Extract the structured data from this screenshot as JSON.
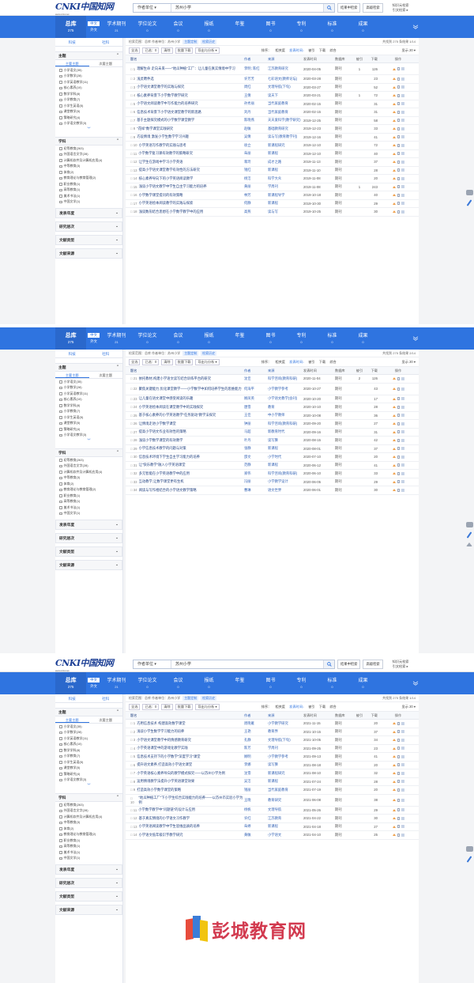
{
  "header": {
    "search_field": "作者单位 ▾",
    "search_value": "苏州小学",
    "btn_in_result": "结果中检索",
    "btn_advanced": "高级检索",
    "right_line1": "知识元检索",
    "right_line2": "引文检索 ▸"
  },
  "tabbar": {
    "zongku_label": "总库",
    "zongku_count": "275",
    "lang_zh": "中文",
    "lang_foreign": "外文",
    "tabs": [
      {
        "label": "学术期刊",
        "count": "21"
      },
      {
        "label": "学位论文",
        "count": "0"
      },
      {
        "label": "会议",
        "count": "0"
      },
      {
        "label": "报纸",
        "count": "0"
      },
      {
        "label": "年鉴",
        "count": ""
      },
      {
        "label": "图书",
        "count": "0"
      },
      {
        "label": "专利",
        "count": "0"
      },
      {
        "label": "标准",
        "count": "0"
      },
      {
        "label": "成果",
        "count": "0"
      }
    ]
  },
  "sidebar": {
    "tab_science": "科技",
    "tab_social": "社科",
    "topic_header": "主题",
    "topic_tab_main": "主要主题",
    "topic_tab_sub": "次要主题",
    "topics": [
      "小学语文(35)",
      "小学数学(28)",
      "小学英语教学(11)",
      "核心素养(10)",
      "数学学科(8)",
      "小学教育(7)",
      "小学生英语(5)",
      "课堂教学(5)",
      "策略研究(4)",
      "小学语文教学(3)"
    ],
    "subject_header": "学科",
    "subjects": [
      "初等教育(263)",
      "外国语言文字(28)",
      "计算机软件及计算机应用(4)",
      "中等教育(3)",
      "体育(2)",
      "教育理论与教育管理(2)",
      "职业教育(1)",
      "高等教育(1)",
      "美术书法(1)",
      "中国文学(1)"
    ],
    "more": "︾",
    "collapsed": [
      "发表年度",
      "研究层次",
      "文献类型",
      "文献来源"
    ]
  },
  "results": {
    "crumbs_label": "检索范围：总库",
    "crumbs_query": "作者单位：苏州小学",
    "tag_main": "主题定制",
    "tag_history": "检索历史",
    "total": "共找到 275 条结果",
    "toolbar": {
      "select_all": "全选",
      "selected": "已选：0",
      "clear": "清除",
      "batch_download": "批量下载",
      "export": "导出与分析 ▾",
      "sort_label": "排序：",
      "sort_relevance": "相关度",
      "sort_date": "发表时间↓",
      "sort_cite": "被引",
      "sort_download": "下载",
      "sort_comprehensive": "综合",
      "display": "显示 20 ▾"
    },
    "columns": [
      "题名",
      "作者",
      "来源",
      "发表时间",
      "数据库",
      "被引",
      "下载",
      "操作"
    ],
    "page1": {
      "pager": "1/14",
      "rows": [
        {
          "idx": "□ 1",
          "title": "理解生命 走向未来——\"地瓜种植\"工厂：让儿童在真实情境中学习",
          "author": "李明; 陈红",
          "source": "江苏教育研究",
          "date": "2020-04-05",
          "db": "期刊",
          "cite": "1",
          "dl": "126"
        },
        {
          "idx": "□ 2",
          "title": "浅灵聘件选",
          "author": "许芳芳",
          "source": "七彩语文(教师论坛)",
          "date": "2020-03-28",
          "db": "期刊",
          "cite": "",
          "dl": "23"
        },
        {
          "idx": "□ 3",
          "title": "小学语文课堂教学的实践与探究",
          "author": "周红",
          "source": "文理导航(下旬)",
          "date": "2020-03-27",
          "db": "期刊",
          "cite": "",
          "dl": "52"
        },
        {
          "idx": "□ 4",
          "title": "核心素养背景下小学数学教学研究",
          "author": "王倩",
          "source": "读天下",
          "date": "2020-03-21",
          "db": "期刊",
          "cite": "1",
          "dl": "72"
        },
        {
          "idx": "□ 5",
          "title": "小学语文阅读教学中写作能力的培养研究",
          "author": "孙秀丽",
          "source": "当代家庭教育",
          "date": "2020-02-15",
          "db": "期刊",
          "cite": "",
          "dl": "31"
        },
        {
          "idx": "□ 6",
          "title": "信息技术背景下小学语文课堂教学的新思路",
          "author": "刘丹",
          "source": "当代家庭教育",
          "date": "2020-02-15",
          "db": "期刊",
          "cite": "",
          "dl": "31"
        },
        {
          "idx": "□ 7",
          "title": "基于主题探究模式的小学数学课堂教学",
          "author": "陈晓燕",
          "source": "天天爱科学(教学研究)",
          "date": "2019-12-25",
          "db": "期刊",
          "cite": "",
          "dl": "58"
        },
        {
          "idx": "□ 8",
          "title": "\"花样\"数学课堂实践研究",
          "author": "赵敏",
          "source": "基础教育研究",
          "date": "2019-12-23",
          "db": "期刊",
          "cite": "",
          "dl": "33"
        },
        {
          "idx": "□ 9",
          "title": "巧设情境 激发小学生数学学习兴趣",
          "author": "吴倩",
          "source": "读与写(教育教学刊)",
          "date": "2019-12-16",
          "db": "期刊",
          "cite": "",
          "dl": "41"
        },
        {
          "idx": "□ 10",
          "title": "小学英语写作教学的实践与思考",
          "author": "徐立",
          "source": "新课程研究",
          "date": "2019-12-10",
          "db": "期刊",
          "cite": "",
          "dl": "72"
        },
        {
          "idx": "□ 11",
          "title": "小学数学复习课有效教学的策略研究",
          "author": "朱丽",
          "source": "新课程",
          "date": "2019-12-10",
          "db": "期刊",
          "cite": "",
          "dl": "40"
        },
        {
          "idx": "□ 12",
          "title": "让学生在游戏中学习小学英语",
          "author": "蒋玲",
          "source": "成才之路",
          "date": "2019-11-13",
          "db": "期刊",
          "cite": "",
          "dl": "37"
        },
        {
          "idx": "□ 13",
          "title": "提高小学语文课堂教学有效性的方法研究",
          "author": "钱红",
          "source": "新课程",
          "date": "2019-11-10",
          "db": "期刊",
          "cite": "",
          "dl": "28"
        },
        {
          "idx": "□ 14",
          "title": "核心素养导向下的小学英语阅读教学",
          "author": "杨洁",
          "source": "科学大众",
          "date": "2019-11-08",
          "db": "期刊",
          "cite": "",
          "dl": "20"
        },
        {
          "idx": "□ 15",
          "title": "浅谈小学语文教学中学生自主学习能力的培养",
          "author": "黄丽",
          "source": "学周刊",
          "date": "2019-11-08",
          "db": "期刊",
          "cite": "1",
          "dl": "243"
        },
        {
          "idx": "□ 16",
          "title": "小学数学课堂提问的有效策略",
          "author": "林芳",
          "source": "新课程导学",
          "date": "2019-10-18",
          "db": "期刊",
          "cite": "",
          "dl": "40"
        },
        {
          "idx": "□ 17",
          "title": "小学英语绘本阅读教学的实践与探索",
          "author": "何静",
          "source": "新课程",
          "date": "2019-10-30",
          "db": "期刊",
          "cite": "",
          "dl": "29"
        },
        {
          "idx": "□ 18",
          "title": "浅谈数形结合思想在小学数学教学中的应用",
          "author": "高燕",
          "source": "读与写",
          "date": "2019-10-25",
          "db": "期刊",
          "cite": "",
          "dl": "30"
        }
      ]
    },
    "page2": {
      "pager": "2/14",
      "rows": [
        {
          "idx": "□ 21",
          "title": "依托教材,构建小学语文读写结合训练平台的研究",
          "author": "沈佳",
          "source": "科学咨询(教育科研)",
          "date": "2020-11-04",
          "db": "期刊",
          "cite": "2",
          "dl": "126"
        },
        {
          "idx": "□ 22",
          "title": "聚焦关键能力,优化课堂教学——小学数学中如何培养学生的思维能力",
          "author": "何海平",
          "source": "小学教学参考",
          "date": "2020-10-27",
          "db": "期刊",
          "cite": "",
          "dl": "43"
        },
        {
          "idx": "□ 23",
          "title": "让儿童在语文课堂中感受阅读的乐趣",
          "author": "顾凤英",
          "source": "小学语文教学(会刊)",
          "date": "2020-10-20",
          "db": "期刊",
          "cite": "",
          "dl": "17"
        },
        {
          "idx": "□ 24",
          "title": "小学英语绘本阅读在课堂教学中的实践探究",
          "author": "唐雪",
          "source": "教育",
          "date": "2020-10-10",
          "db": "期刊",
          "cite": "",
          "dl": "28"
        },
        {
          "idx": "□ 25",
          "title": "基于核心素养的小学英语教学\"任务驱动\"教学法探究",
          "author": "王佳",
          "source": "中小学教师",
          "date": "2020-10-08",
          "db": "期刊",
          "cite": "",
          "dl": "36"
        },
        {
          "idx": "□ 26",
          "title": "让情境走进小学数学课堂",
          "author": "钟丽",
          "source": "科学咨询(教育科研)",
          "date": "2020-09-20",
          "db": "期刊",
          "cite": "",
          "dl": "27"
        },
        {
          "idx": "□ 27",
          "title": "提高小学语文作业有效性的策略",
          "author": "马超",
          "source": "新教育时代",
          "date": "2020-09-16",
          "db": "期刊",
          "cite": "",
          "dl": "31"
        },
        {
          "idx": "□ 28",
          "title": "浅谈小学数学课堂的有效教学",
          "author": "叶丹",
          "source": "读写算",
          "date": "2020-08-15",
          "db": "期刊",
          "cite": "",
          "dl": "42"
        },
        {
          "idx": "□ 29",
          "title": "小学信息技术教学的问题与对策",
          "author": "张静",
          "source": "新课程",
          "date": "2020-08-01",
          "db": "期刊",
          "cite": "",
          "dl": "37"
        },
        {
          "idx": "□ 30",
          "title": "信息技术环境下学生自主学习能力的培养",
          "author": "邵文",
          "source": "小学时代",
          "date": "2020-07-10",
          "db": "期刊",
          "cite": "",
          "dl": "20"
        },
        {
          "idx": "□ 31",
          "title": "让\"快乐教学\"融入小学英语课堂",
          "author": "范静",
          "source": "新课程",
          "date": "2020-06-12",
          "db": "期刊",
          "cite": "",
          "dl": "41"
        },
        {
          "idx": "□ 32",
          "title": "多元智能在小学英语教学中的应用",
          "author": "郑伟",
          "source": "科学咨询(教育科研)",
          "date": "2020-06-10",
          "db": "期刊",
          "cite": "",
          "dl": "33"
        },
        {
          "idx": "□ 33",
          "title": "互动教学,让数学课堂更有生机",
          "author": "冯丽",
          "source": "小学教学设计",
          "date": "2020-06-05",
          "db": "期刊",
          "cite": "",
          "dl": "29"
        },
        {
          "idx": "□ 34",
          "title": "阅读与写作相结合的小学语文教学策略",
          "author": "曹琳",
          "source": "语文世界",
          "date": "2020-06-01",
          "db": "期刊",
          "cite": "",
          "dl": "30"
        }
      ]
    },
    "page3": {
      "pager": "1/14",
      "rows": [
        {
          "idx": "□ 1",
          "title": "巧用信息技术 构建高效数学课堂",
          "author": "周晓雁",
          "source": "小学教学研究",
          "date": "2021-11-15",
          "db": "期刊",
          "cite": "",
          "dl": "20"
        },
        {
          "idx": "□ 2",
          "title": "浅谈小学生数学学习能力的培养",
          "author": "王艳",
          "source": "教育界",
          "date": "2021-10-15",
          "db": "期刊",
          "cite": "",
          "dl": "37"
        },
        {
          "idx": "□ 3",
          "title": "小学语文课堂教学中的情感教育研究",
          "author": "孔静",
          "source": "文理导航(下旬)",
          "date": "2021-10-05",
          "db": "期刊",
          "cite": "",
          "dl": "34"
        },
        {
          "idx": "□ 4",
          "title": "小学英语课堂中的游戏化教学实践",
          "author": "陈芳",
          "source": "学周刊",
          "date": "2021-09-25",
          "db": "期刊",
          "cite": "",
          "dl": "23"
        },
        {
          "idx": "□ 5",
          "title": "信息技术支持下的小学数学\"深度学习\"课堂",
          "author": "顾明",
          "source": "小学教学参考",
          "date": "2021-09-13",
          "db": "期刊",
          "cite": "",
          "dl": "41"
        },
        {
          "idx": "□ 6",
          "title": "提升语文素养,打造高效小学语文课堂",
          "author": "李娜",
          "source": "读写算",
          "date": "2021-08-18",
          "db": "期刊",
          "cite": "",
          "dl": "20"
        },
        {
          "idx": "□ 7",
          "title": "小学英语核心素养导向的教学模式探究——以苏州小学为例",
          "author": "沈雪",
          "source": "新课程研究",
          "date": "2021-08-10",
          "db": "期刊",
          "cite": "",
          "dl": "32"
        },
        {
          "idx": "□ 8",
          "title": "运用情境教学法提升小学英语课堂效果",
          "author": "吴洁",
          "source": "新课程",
          "date": "2021-07-24",
          "db": "期刊",
          "cite": "",
          "dl": "28"
        },
        {
          "idx": "□ 9",
          "title": "打造高效小学数学课堂的策略",
          "author": "钱丽",
          "source": "当代家庭教育",
          "date": "2021-07-19",
          "db": "期刊",
          "cite": "",
          "dl": "20"
        },
        {
          "idx": "□ 10",
          "title": "\"地瓜种植工厂\"下小学生综合实践能力的培养——以苏州市实验小学为例",
          "author": "王晓",
          "source": "教育研究",
          "date": "2021-06-08",
          "db": "期刊",
          "cite": "",
          "dl": "38"
        },
        {
          "idx": "□ 11",
          "title": "小学数学教学中\"问题链\"的设计与应用",
          "author": "杨帆",
          "source": "文理导航",
          "date": "2021-05-26",
          "db": "期刊",
          "cite": "",
          "dl": "29"
        },
        {
          "idx": "□ 12",
          "title": "基于真实情境的小学语文习作教学",
          "author": "许红",
          "source": "江苏教育",
          "date": "2021-04-22",
          "db": "期刊",
          "cite": "",
          "dl": "30"
        },
        {
          "idx": "□ 13",
          "title": "小学英语阅读教学中学生思维品质的培养",
          "author": "朱婷",
          "source": "新课程",
          "date": "2021-04-18",
          "db": "期刊",
          "cite": "",
          "dl": "27"
        },
        {
          "idx": "□ 14",
          "title": "小学语文低年级识字教学研究",
          "author": "黄敏",
          "source": "小学语文",
          "date": "2021-04-10",
          "db": "期刊",
          "cite": "",
          "dl": "25"
        }
      ]
    }
  },
  "watermark": {
    "text": "彭城教育网"
  }
}
